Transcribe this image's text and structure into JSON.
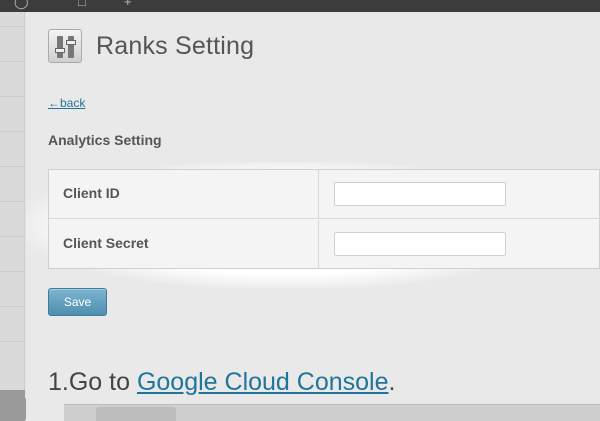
{
  "page": {
    "title": "Ranks Setting",
    "back_link": "←back",
    "section_heading": "Analytics Setting"
  },
  "form": {
    "fields": [
      {
        "label": "Client ID",
        "value": ""
      },
      {
        "label": "Client Secret",
        "value": ""
      }
    ],
    "save_label": "Save"
  },
  "instructions": {
    "step1_prefix": "1.Go to ",
    "step1_link": "Google Cloud Console",
    "step1_suffix": "."
  },
  "colors": {
    "link": "#21759b",
    "save_button": "#5f9dbd"
  },
  "icons": {
    "title_icon": "settings-sliders-icon"
  }
}
